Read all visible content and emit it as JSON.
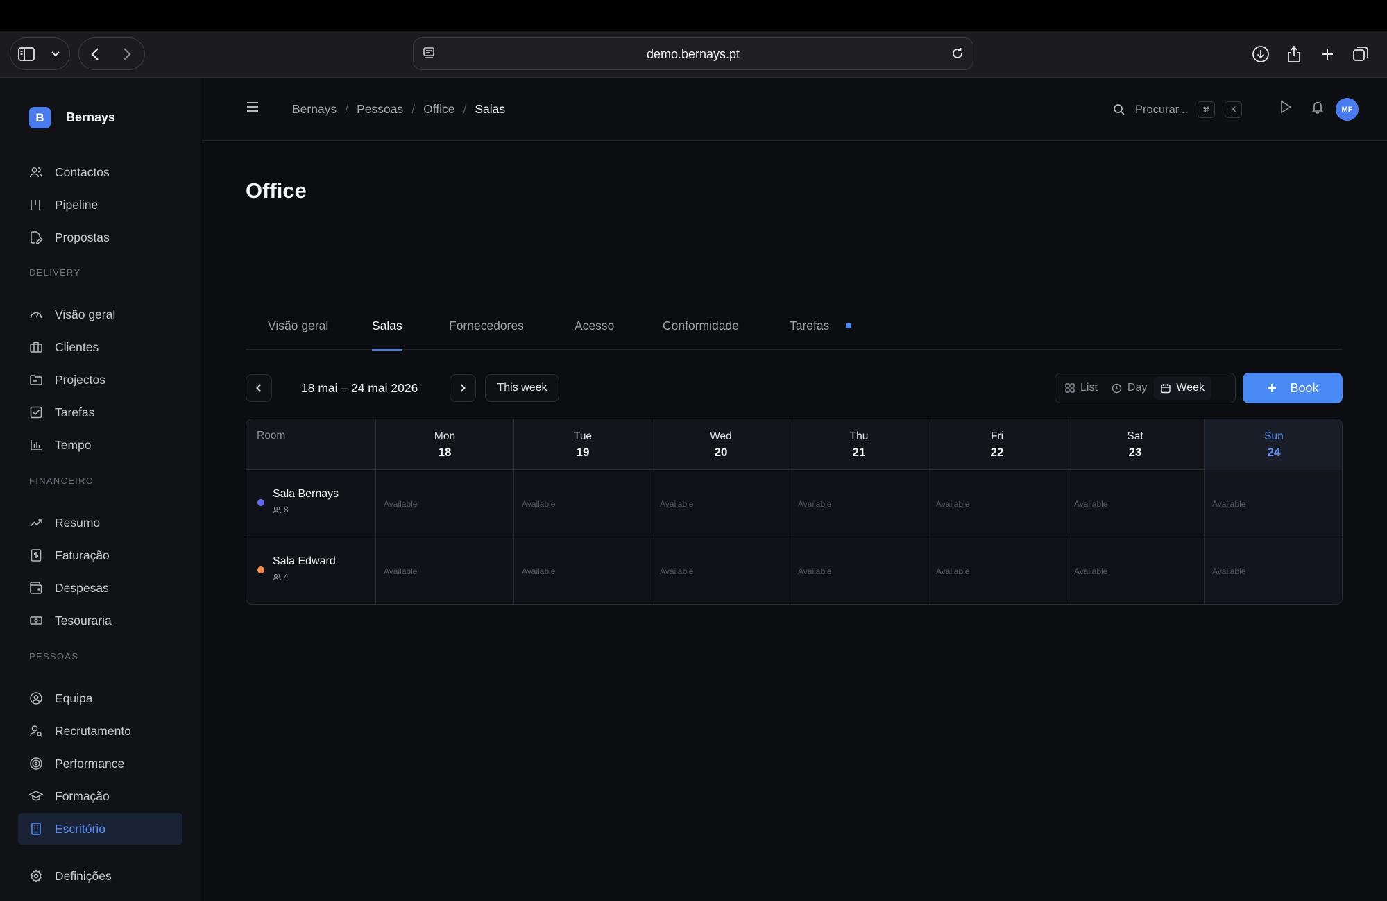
{
  "browser": {
    "url": "demo.bernays.pt"
  },
  "sidebar": {
    "brand": {
      "logo_letter": "B",
      "name": "Bernays"
    },
    "main_items": [
      {
        "label": "Contactos",
        "icon": "users-icon"
      },
      {
        "label": "Pipeline",
        "icon": "pipeline-icon"
      },
      {
        "label": "Propostas",
        "icon": "document-edit-icon"
      }
    ],
    "sections": [
      {
        "title": "DELIVERY",
        "items": [
          {
            "label": "Visão geral",
            "icon": "gauge-icon"
          },
          {
            "label": "Clientes",
            "icon": "building-icon"
          },
          {
            "label": "Projectos",
            "icon": "folder-icon"
          },
          {
            "label": "Tarefas",
            "icon": "checkbox-icon"
          },
          {
            "label": "Tempo",
            "icon": "bar-chart-icon"
          }
        ]
      },
      {
        "title": "FINANCEIRO",
        "items": [
          {
            "label": "Resumo",
            "icon": "trend-icon"
          },
          {
            "label": "Faturação",
            "icon": "invoice-icon"
          },
          {
            "label": "Despesas",
            "icon": "wallet-icon"
          },
          {
            "label": "Tesouraria",
            "icon": "banknote-icon"
          }
        ]
      },
      {
        "title": "PESSOAS",
        "items": [
          {
            "label": "Equipa",
            "icon": "user-circle-icon"
          },
          {
            "label": "Recrutamento",
            "icon": "user-search-icon"
          },
          {
            "label": "Performance",
            "icon": "target-icon"
          },
          {
            "label": "Formação",
            "icon": "graduation-cap-icon"
          },
          {
            "label": "Escritório",
            "icon": "office-building-icon",
            "active": true
          }
        ]
      }
    ],
    "footer_item": {
      "label": "Definições",
      "icon": "gear-icon"
    }
  },
  "header": {
    "breadcrumb": [
      "Bernays",
      "Pessoas",
      "Office",
      "Salas"
    ],
    "search_placeholder": "Procurar...",
    "shortcut_keys": [
      "⌘",
      "K"
    ],
    "avatar_initials": "MF"
  },
  "page": {
    "title": "Office",
    "tabs": [
      {
        "label": "Visão geral"
      },
      {
        "label": "Salas",
        "active": true
      },
      {
        "label": "Fornecedores"
      },
      {
        "label": "Acesso"
      },
      {
        "label": "Conformidade"
      },
      {
        "label": "Tarefas",
        "has_dot": true
      }
    ],
    "date_range": "18 mai – 24 mai 2026",
    "this_week_label": "This week",
    "view_options": [
      {
        "label": "List",
        "icon": "grid-icon"
      },
      {
        "label": "Day",
        "icon": "clock-icon"
      },
      {
        "label": "Week",
        "icon": "calendar-icon",
        "active": true
      }
    ],
    "book_label": "Book"
  },
  "calendar": {
    "room_header": "Room",
    "days": [
      {
        "name": "Mon",
        "num": "18"
      },
      {
        "name": "Tue",
        "num": "19"
      },
      {
        "name": "Wed",
        "num": "20"
      },
      {
        "name": "Thu",
        "num": "21"
      },
      {
        "name": "Fri",
        "num": "22"
      },
      {
        "name": "Sat",
        "num": "23"
      },
      {
        "name": "Sun",
        "num": "24",
        "today": true
      }
    ],
    "rooms": [
      {
        "name": "Sala Bernays",
        "capacity": "8",
        "color": "#6366f1"
      },
      {
        "name": "Sala Edward",
        "capacity": "4",
        "color": "#f28c4a"
      }
    ],
    "slot_label": "Available"
  },
  "colors": {
    "accent": "#4a8af4",
    "active_text": "#5d8ff2",
    "background": "#0c0d11"
  }
}
